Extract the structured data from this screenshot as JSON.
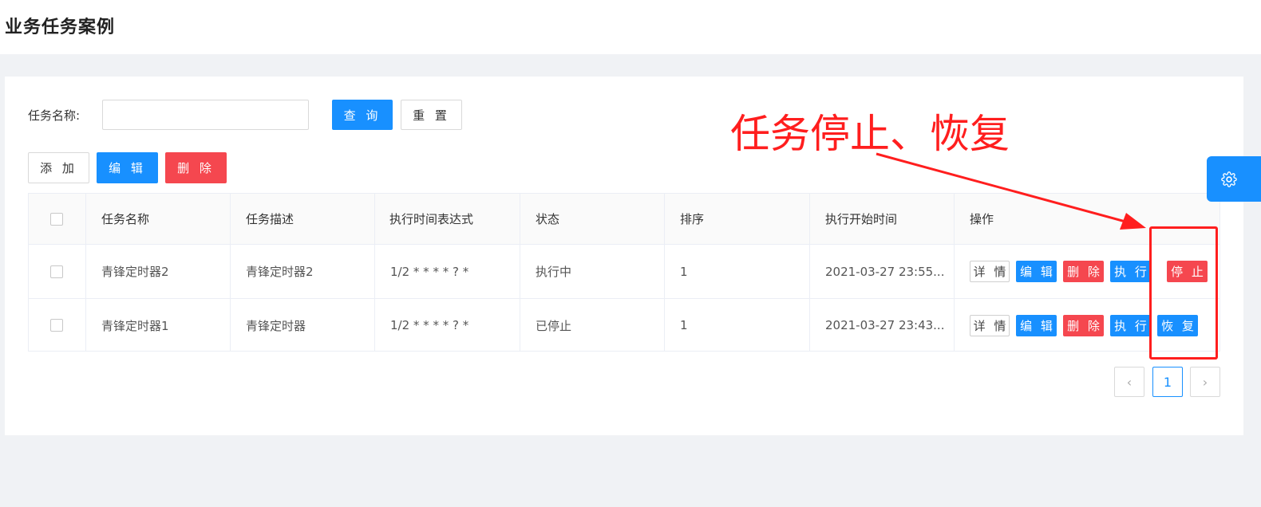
{
  "page": {
    "title": "业务任务案例"
  },
  "search": {
    "label": "任务名称:",
    "value": "",
    "placeholder": "",
    "query_label": "查 询",
    "reset_label": "重 置"
  },
  "toolbar": {
    "add_label": "添 加",
    "edit_label": "编 辑",
    "delete_label": "删 除"
  },
  "table": {
    "columns": [
      "任务名称",
      "任务描述",
      "执行时间表达式",
      "状态",
      "排序",
      "执行开始时间",
      "操作"
    ],
    "rows": [
      {
        "name": "青锋定时器2",
        "desc": "青锋定时器2",
        "cron": "1/2 * * * * ? *",
        "status": "执行中",
        "order": "1",
        "start": "2021-03-27 23:55...",
        "toggle": "停 止"
      },
      {
        "name": "青锋定时器1",
        "desc": "青锋定时器",
        "cron": "1/2 * * * * ? *",
        "status": "已停止",
        "order": "1",
        "start": "2021-03-27 23:43...",
        "toggle": "恢 复"
      }
    ],
    "actions": {
      "detail": "详 情",
      "edit": "编 辑",
      "delete": "删 除",
      "run": "执 行"
    }
  },
  "pagination": {
    "prev_icon": "‹",
    "current": "1",
    "next_icon": "›"
  },
  "settings": {
    "icon": "gear-icon"
  },
  "annotation": {
    "text": "任务停止、恢复",
    "color": "#ff1e1e"
  },
  "colors": {
    "primary": "#1890ff",
    "danger": "#f5474f"
  }
}
